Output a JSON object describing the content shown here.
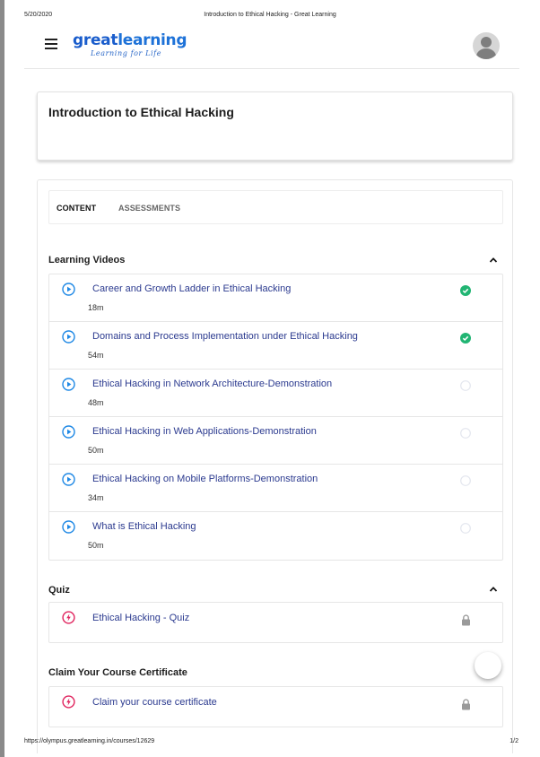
{
  "print_header": {
    "date": "5/20/2020",
    "title": "Introduction to Ethical Hacking - Great Learning"
  },
  "print_footer": {
    "url": "https://olympus.greatlearning.in/courses/12629",
    "page": "1/2"
  },
  "header": {
    "logo_part1": "great",
    "logo_part2": "learning",
    "logo_tagline": "Learning for Life"
  },
  "course": {
    "title": "Introduction to Ethical Hacking"
  },
  "tabs": {
    "content": "CONTENT",
    "assessments": "ASSESSMENTS"
  },
  "learning_videos": {
    "title": "Learning Videos",
    "items": [
      {
        "label": "Career and Growth Ladder in Ethical Hacking",
        "duration": "18m",
        "completed": true
      },
      {
        "label": "Domains and Process Implementation under Ethical Hacking",
        "duration": "54m",
        "completed": true
      },
      {
        "label": "Ethical Hacking in Network Architecture-Demonstration",
        "duration": "48m",
        "completed": false
      },
      {
        "label": "Ethical Hacking in Web Applications-Demonstration",
        "duration": "50m",
        "completed": false
      },
      {
        "label": "Ethical Hacking on Mobile Platforms-Demonstration",
        "duration": "34m",
        "completed": false
      },
      {
        "label": "What is Ethical Hacking",
        "duration": "50m",
        "completed": false
      }
    ]
  },
  "quiz": {
    "title": "Quiz",
    "item_label": "Ethical Hacking - Quiz"
  },
  "certificate": {
    "title": "Claim Your Course Certificate",
    "item_label": "Claim your course certificate"
  },
  "colors": {
    "brand_blue": "#1a5dcc",
    "link_text": "#2b3a8f",
    "play_icon": "#1e88e5",
    "complete_green": "#21b573",
    "quiz_icon": "#e0245e",
    "pending_circle": "#e3e6ee"
  }
}
